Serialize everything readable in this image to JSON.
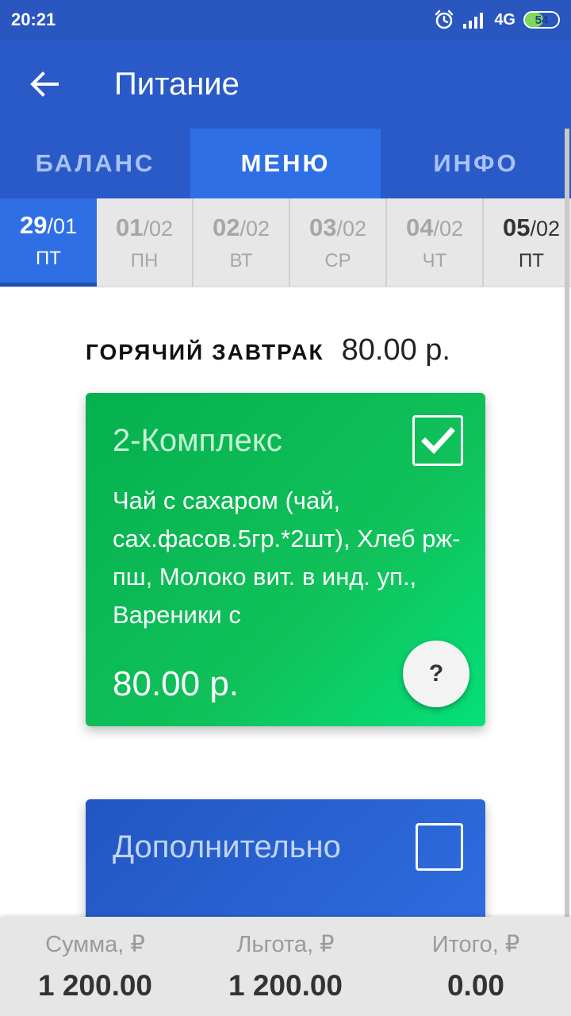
{
  "status_bar": {
    "time": "20:21",
    "network": "4G",
    "battery_level": "54",
    "icons": [
      "alarm-icon",
      "signal-icon",
      "battery-icon"
    ]
  },
  "app_bar": {
    "title": "Питание",
    "back_icon": "arrow-left-icon"
  },
  "tabs": [
    {
      "label": "БАЛАНС",
      "active": false
    },
    {
      "label": "МЕНЮ",
      "active": true
    },
    {
      "label": "ИНФО",
      "active": false
    }
  ],
  "dates": [
    {
      "day": "29",
      "month": "/01",
      "weekday": "ПТ",
      "state": "active"
    },
    {
      "day": "01",
      "month": "/02",
      "weekday": "ПН",
      "state": "disabled"
    },
    {
      "day": "02",
      "month": "/02",
      "weekday": "ВТ",
      "state": "disabled"
    },
    {
      "day": "03",
      "month": "/02",
      "weekday": "СР",
      "state": "disabled"
    },
    {
      "day": "04",
      "month": "/02",
      "weekday": "ЧТ",
      "state": "disabled"
    },
    {
      "day": "05",
      "month": "/02",
      "weekday": "ПТ",
      "state": "normal"
    }
  ],
  "section": {
    "title": "ГОРЯЧИЙ ЗАВТРАК",
    "price": "80.00 р."
  },
  "cards": [
    {
      "title": "2-Комплекс",
      "description": "Чай с сахаром (чай, сах.фасов.5гр.*2шт), Хлеб рж-пш, Молоко вит. в инд. уп., Вареники с",
      "price": "80.00 р.",
      "checked": true,
      "help_label": "?"
    },
    {
      "title": "Дополнительно",
      "checked": false
    }
  ],
  "summary": [
    {
      "label": "Сумма, ₽",
      "value": "1 200.00"
    },
    {
      "label": "Льгота, ₽",
      "value": "1 200.00"
    },
    {
      "label": "Итого, ₽",
      "value": "0.00"
    }
  ],
  "colors": {
    "primary": "#2a5ac8",
    "active_tab": "#2f6fe6",
    "card_green": "#10c15a",
    "card_blue": "#2f6ee0"
  }
}
